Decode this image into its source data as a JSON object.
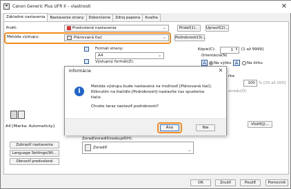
{
  "window": {
    "title": "Canon Generic Plus UFR II – vlastnosti",
    "close_glyph": "✕"
  },
  "tabs": [
    {
      "label": "Základné nastavenia",
      "active": true
    },
    {
      "label": "Nastavenie strany",
      "active": false
    },
    {
      "label": "Dokončenie",
      "active": false
    },
    {
      "label": "Zdroj papiera",
      "active": false
    },
    {
      "label": "Kvalita",
      "active": false
    }
  ],
  "profile": {
    "label": "Profil:",
    "value": "Predvolené nastavenia",
    "add_button": "Pridať(1)...",
    "edit_button": "Upraviť(2)..."
  },
  "output_method": {
    "label": "Metóda výstupu:",
    "value": "Plánovaná tlač",
    "details_button": "Podrobnosti(3)...",
    "highlight_color": "#f28c1c"
  },
  "page_size": {
    "label": "Formát strany:",
    "value": "A4"
  },
  "output_size": {
    "label": "Výstupný formát(Z):"
  },
  "copies": {
    "label": "Kópie(C):",
    "value": "1",
    "range": "[1 až 9999]"
  },
  "orientation": {
    "label": "Orientácia(N)",
    "portrait": "Na výšku",
    "landscape": "Na šírku",
    "portrait_letter": "A",
    "landscape_letter": "A"
  },
  "scale": {
    "label_partial": "rka",
    "value": "100",
    "range": "% [25 až 200]",
    "manual_partial": "stredu(Ó)"
  },
  "watermark_button": "Vložiť(J)...",
  "preview_caption": "A4 [Mierka: Automaticky]",
  "left_buttons": [
    "Zobraziť nastavenia",
    "Language Settings(W)...",
    "Obnoviť predvolené"
  ],
  "layout": {
    "label": "Zoraď/zoradiť/zoskupiť(H):",
    "value": "Zoradiť"
  },
  "footer": {
    "ok": "OK",
    "cancel": "Zrušiť",
    "apply": "Použiť",
    "help": "Pomocník"
  },
  "dialog": {
    "title": "Informácie",
    "message_line1": "Metóda výstupu bude nastavená na možnosť [Plánovaná tlač].",
    "message_line2": "Kliknutím na tlačidlo [Podrobnosti] nastavíte čas spustenia",
    "message_line3": "tlače.",
    "question": "Chcete teraz nastaviť podrobnosti?",
    "yes": "Áno",
    "no": "Nie",
    "icon_glyph": "i",
    "close_glyph": "✕"
  }
}
